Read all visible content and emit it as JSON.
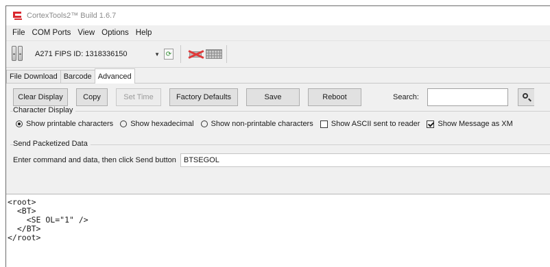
{
  "window": {
    "title": "CortexTools2™ Build 1.6.7"
  },
  "menu": {
    "items": [
      "File",
      "COM Ports",
      "View",
      "Options",
      "Help"
    ]
  },
  "toolbar": {
    "device": "A271 FIPS ID: 1318336150"
  },
  "tabs": [
    {
      "label": "File Download",
      "active": false
    },
    {
      "label": "Barcode",
      "active": false
    },
    {
      "label": "Advanced",
      "active": true
    }
  ],
  "actions": {
    "clear_display": "Clear Display",
    "copy": "Copy",
    "set_time": "Set Time",
    "factory_defaults": "Factory Defaults",
    "save": "Save",
    "reboot": "Reboot",
    "search_label": "Search:",
    "search_value": ""
  },
  "character_display": {
    "title": "Character Display",
    "options": [
      {
        "label": "Show printable characters",
        "type": "radio",
        "checked": true
      },
      {
        "label": "Show hexadecimal",
        "type": "radio",
        "checked": false
      },
      {
        "label": "Show non-printable characters",
        "type": "radio",
        "checked": false
      },
      {
        "label": "Show ASCII sent to reader",
        "type": "checkbox",
        "checked": false
      },
      {
        "label": "Show Message as XM",
        "type": "checkbox",
        "checked": true
      }
    ]
  },
  "send": {
    "title": "Send Packetized Data",
    "instruction": "Enter command and data, then click Send button",
    "value": "BTSEGOL"
  },
  "output": {
    "text": "<root>\n  <BT>\n    <SE OL=\"1\" />\n  </BT>\n</root>"
  }
}
